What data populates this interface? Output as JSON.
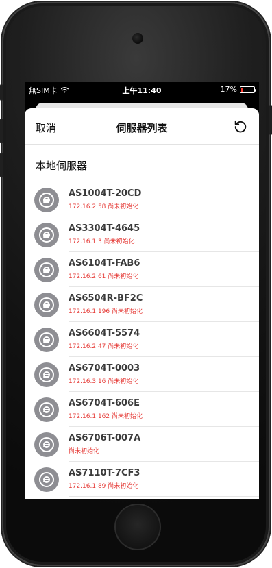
{
  "status_bar": {
    "carrier": "無SIM卡",
    "time": "上午11:40",
    "battery": "17%"
  },
  "nav": {
    "cancel_label": "取消",
    "title": "伺服器列表",
    "refresh_icon": "refresh-icon"
  },
  "section": {
    "title": "本地伺服器"
  },
  "servers": [
    {
      "name": "AS1004T-20CD",
      "info": "172.16.2.58 尚未初始化"
    },
    {
      "name": "AS3304T-4645",
      "info": "172.16.1.3 尚未初始化"
    },
    {
      "name": "AS6104T-FAB6",
      "info": "172.16.2.61 尚未初始化"
    },
    {
      "name": "AS6504R-BF2C",
      "info": "172.16.1.196 尚未初始化"
    },
    {
      "name": "AS6604T-5574",
      "info": "172.16.2.47 尚未初始化"
    },
    {
      "name": "AS6704T-0003",
      "info": "172.16.3.16 尚未初始化"
    },
    {
      "name": "AS6704T-606E",
      "info": "172.16.1.162 尚未初始化"
    },
    {
      "name": "AS6706T-007A",
      "info": " 尚未初始化"
    },
    {
      "name": "AS7110T-7CF3",
      "info": "172.16.1.89 尚未初始化"
    }
  ],
  "colors": {
    "status_text": "#e53935",
    "avatar_bg": "#8e8e93"
  }
}
